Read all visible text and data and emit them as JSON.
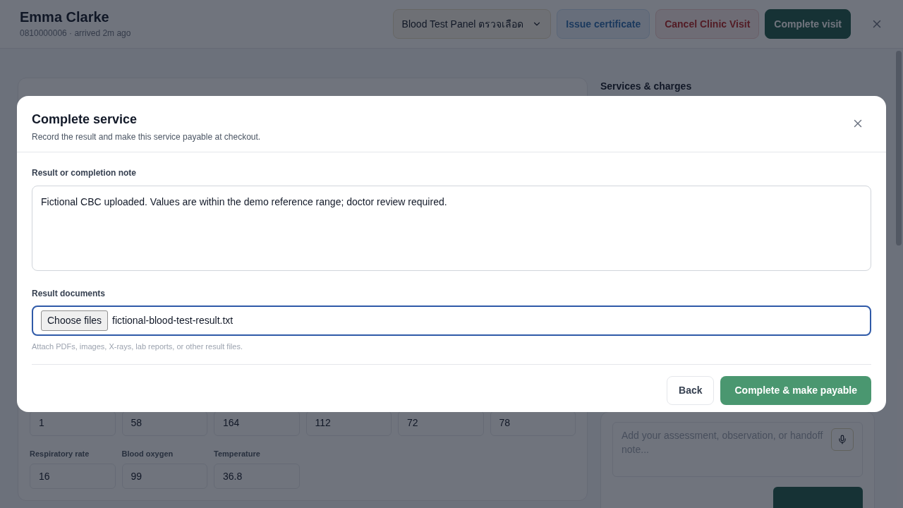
{
  "header": {
    "patient_name": "Emma Clarke",
    "subtitle": "0810000006 · arrived 2m ago",
    "service_select": "Blood Test Panel ตรวจเลือด",
    "buttons": [
      {
        "label": "Issue certificate",
        "kind": "info"
      },
      {
        "label": "Cancel Clinic Visit",
        "kind": "danger"
      },
      {
        "label": "Complete visit",
        "kind": "primary"
      }
    ]
  },
  "vitals": [
    {
      "value": "1"
    },
    {
      "value": "58"
    },
    {
      "value": "164"
    },
    {
      "value": "112"
    },
    {
      "value": "72"
    },
    {
      "value": "78"
    },
    {
      "label": "Respiratory rate",
      "value": "16"
    },
    {
      "label": "Blood oxygen",
      "value": "99"
    },
    {
      "label": "Temperature",
      "value": "36.8"
    }
  ],
  "sidebar": {
    "title": "Services & charges",
    "notes_placeholder": "Add your assessment, observation, or handoff note..."
  },
  "dialog": {
    "title": "Complete service",
    "subtitle": "Record the result and make this service payable at checkout.",
    "note_label": "Result or completion note",
    "note_value": "Fictional CBC uploaded. Values are within the demo reference range; doctor review required.",
    "documents_label": "Result documents",
    "choose_button": "Choose files",
    "file_name": "fictional-blood-test-result.txt",
    "documents_hint": "Attach PDFs, images, X-rays, lab reports, or other result files.",
    "back_button": "Back",
    "submit_button": "Complete & make payable"
  }
}
